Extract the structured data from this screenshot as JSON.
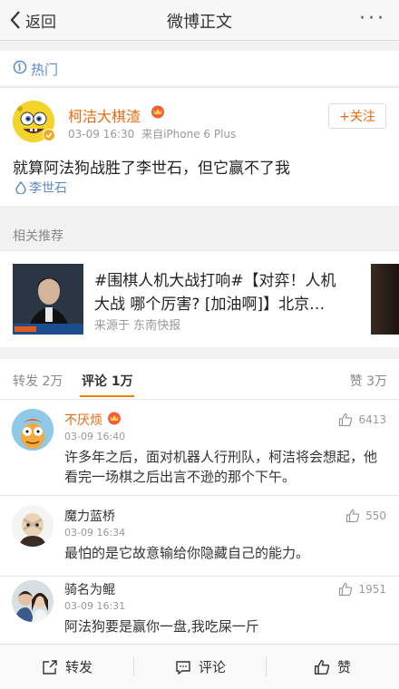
{
  "nav": {
    "back_label": "返回",
    "title": "微博正文",
    "more_label": "···"
  },
  "hot": {
    "label": "热门"
  },
  "post": {
    "username": "柯洁大棋渣",
    "time": "03-09 16:30",
    "source": "来自iPhone 6 Plus",
    "follow_label": "+关注",
    "text": "就算阿法狗战胜了李世石，但它赢不了我",
    "topic": "李世石"
  },
  "related": {
    "section_title": "相关推荐",
    "line1": "#围棋人机大战打响#【对弈！人机",
    "line2": "大战 哪个厉害? [加油啊]】北京…",
    "source": "来源于 东南快报",
    "image_caption": "人工智能"
  },
  "tabs": {
    "repost": "转发 2万",
    "comment": "评论 1万",
    "like": "赞 3万"
  },
  "comments": [
    {
      "name": "不厌烦",
      "time": "03-09 16:40",
      "likes": "6413",
      "text": "许多年之后，面对机器人行刑队，柯洁将会想起，他看完一场棋之后出言不逊的那个下午。"
    },
    {
      "name": "魔力蓝桥",
      "time": "03-09 16:34",
      "likes": "550",
      "text": "最怕的是它故意输给你隐藏自己的能力。"
    },
    {
      "name": "骑名为鲲",
      "time": "03-09 16:31",
      "likes": "1951",
      "text": "阿法狗要是赢你一盘,我吃屎一斤"
    }
  ],
  "bottom": {
    "repost": "转发",
    "comment": "评论",
    "like": "赞"
  },
  "colors": {
    "accent": "#f08300",
    "username": "#e86b0f",
    "link": "#5a8ac6"
  }
}
